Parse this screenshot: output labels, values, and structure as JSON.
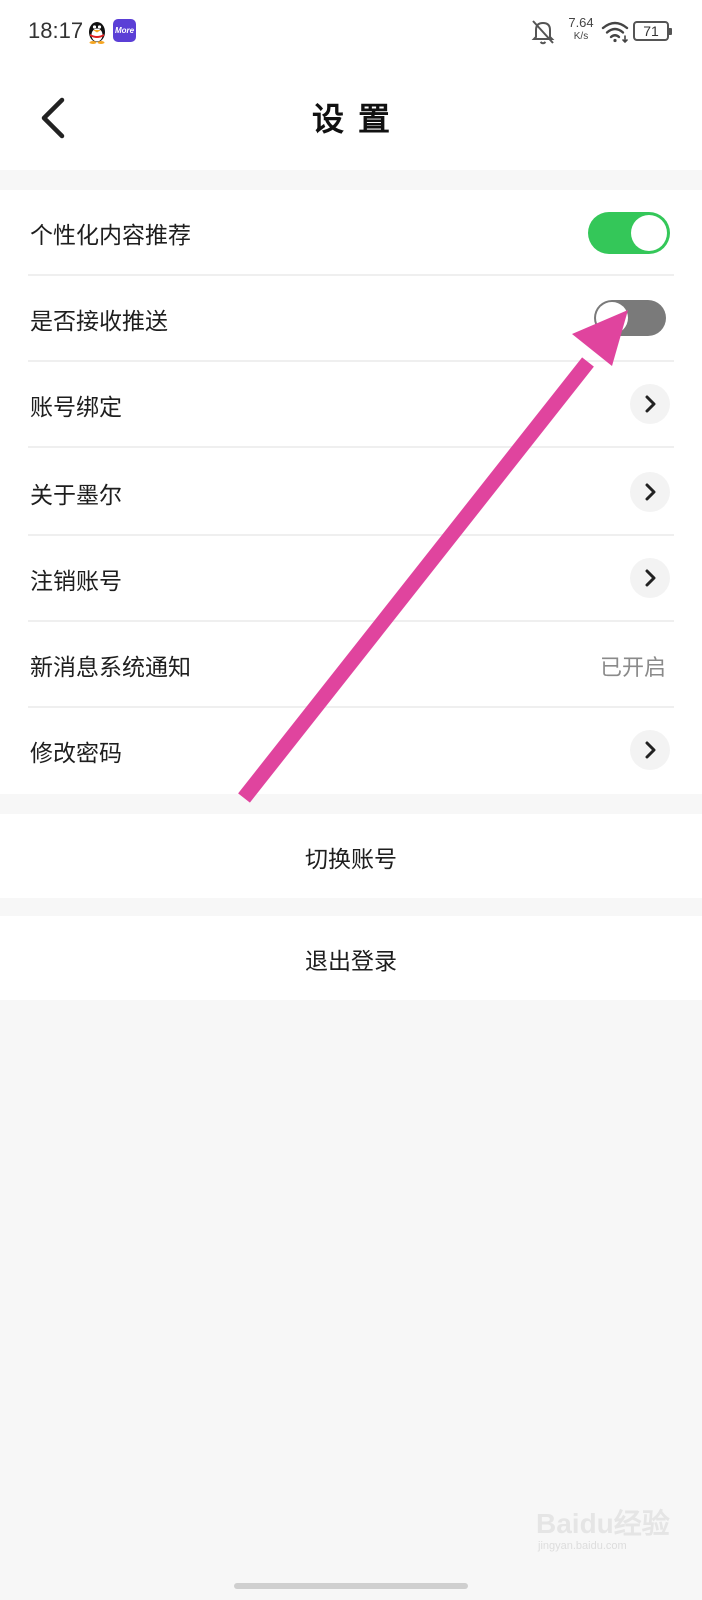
{
  "status_bar": {
    "time": "18:17",
    "app_badge": "More",
    "net_speed": "7.64",
    "net_speed_unit": "K/s",
    "battery": "71"
  },
  "header": {
    "title": "设置"
  },
  "settings": {
    "items": [
      {
        "label": "个性化内容推荐",
        "control": "toggle",
        "state": "on"
      },
      {
        "label": "是否接收推送",
        "control": "toggle",
        "state": "off"
      },
      {
        "label": "账号绑定",
        "control": "chevron"
      },
      {
        "label": "关于墨尔",
        "control": "chevron"
      },
      {
        "label": "注销账号",
        "control": "chevron"
      },
      {
        "label": "新消息系统通知",
        "control": "value",
        "value": "已开启"
      },
      {
        "label": "修改密码",
        "control": "chevron"
      }
    ]
  },
  "actions": {
    "switch_account": "切换账号",
    "logout": "退出登录"
  },
  "watermark": {
    "main": "Baidu经验",
    "sub": "jingyan.baidu.com"
  },
  "colors": {
    "toggle_on": "#34c759",
    "toggle_off": "#7a7a7a",
    "annotation_arrow": "#e0449e"
  }
}
